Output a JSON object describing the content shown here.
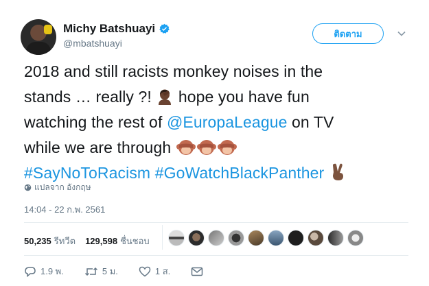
{
  "user": {
    "name": "Michy Batshuayi",
    "handle": "@mbatshuayi",
    "verified": true
  },
  "follow_button": {
    "label": "ติดตาม"
  },
  "tweet": {
    "line1": "2018 and still racists monkey noises in the",
    "line2_a": "stands … really ?! ",
    "line2_b": " hope you have fun",
    "line3_a": "watching the rest of ",
    "line3_mention": "@EuropaLeague",
    "line3_b": " on TV",
    "line4_a": "while we are through ",
    "hashtag1": "#SayNoToRacism",
    "hashtag2": "#GoWatchBlackPanther",
    "emojis": [
      "facepalm-emoji",
      "see-no-evil-monkey-emoji",
      "see-no-evil-monkey-emoji",
      "see-no-evil-monkey-emoji",
      "victory-hand-emoji"
    ]
  },
  "translate": {
    "label": "แปลจาก อังกฤษ"
  },
  "timestamp": "14:04 - 22 ก.พ. 2561",
  "stats": {
    "retweets_count": "50,235",
    "retweets_label": "รีทวีต",
    "likes_count": "129,598",
    "likes_label": "ชื่นชอบ"
  },
  "actions": {
    "reply": "1.9 พ.",
    "retweet": "5 ม.",
    "like": "1 ส."
  },
  "colors": {
    "link": "#1b95e0",
    "accent": "#1da1f2",
    "secondary_text": "#657786"
  }
}
